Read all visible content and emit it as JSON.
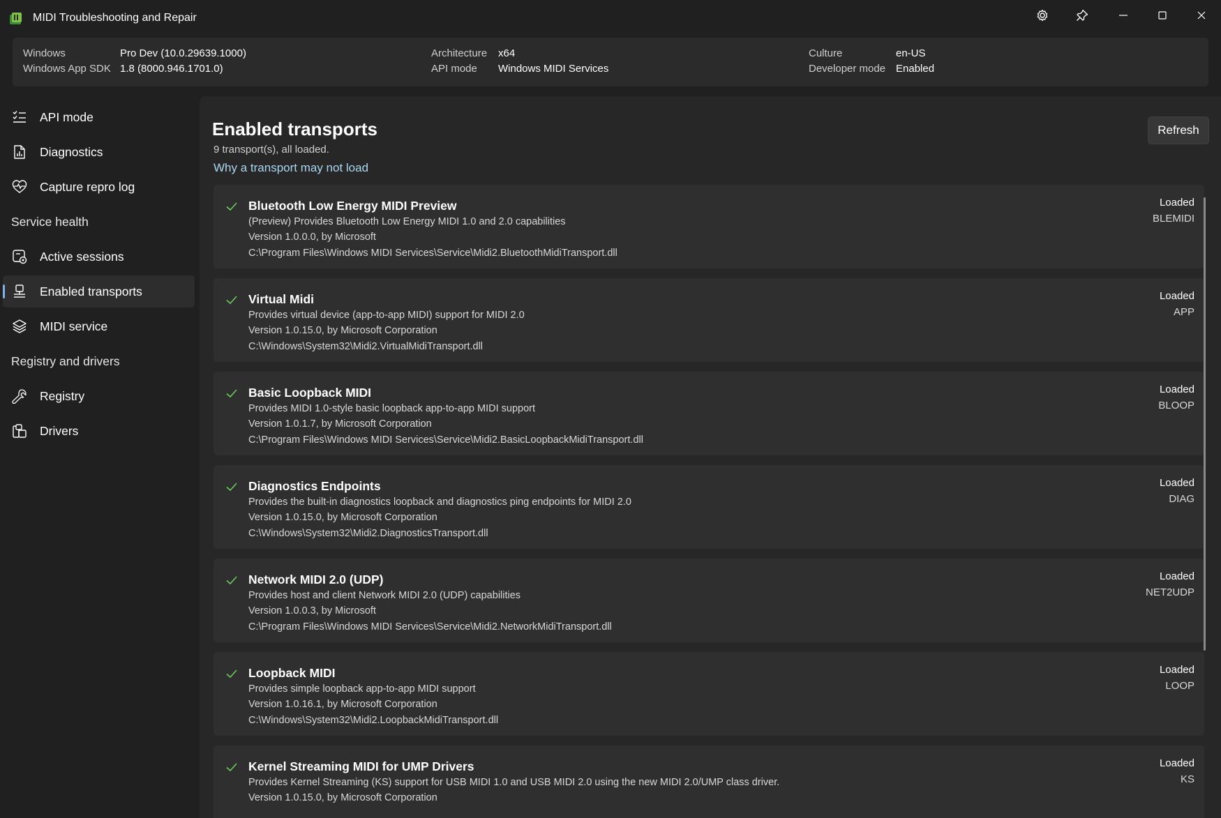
{
  "window": {
    "title": "MIDI Troubleshooting and Repair",
    "icons": [
      "settings-icon",
      "pin-icon",
      "minimize-icon",
      "maximize-icon",
      "close-icon"
    ]
  },
  "info": {
    "windows_label": "Windows",
    "windows_value": "Pro Dev (10.0.29639.1000)",
    "sdk_label": "Windows App SDK",
    "sdk_value": "1.8 (8000.946.1701.0)",
    "arch_label": "Architecture",
    "arch_value": "x64",
    "api_label": "API mode",
    "api_value": "Windows MIDI Services",
    "culture_label": "Culture",
    "culture_value": "en-US",
    "dev_label": "Developer mode",
    "dev_value": "Enabled"
  },
  "sidebar": {
    "items": [
      {
        "label": "API mode",
        "icon": "checklist-icon"
      },
      {
        "label": "Diagnostics",
        "icon": "document-chart-icon"
      },
      {
        "label": "Capture repro log",
        "icon": "heart-pulse-icon"
      },
      {
        "label": "Active sessions",
        "icon": "sessions-icon"
      },
      {
        "label": "Enabled transports",
        "icon": "transport-icon"
      },
      {
        "label": "MIDI service",
        "icon": "layers-icon"
      },
      {
        "label": "Registry",
        "icon": "wrench-icon"
      },
      {
        "label": "Drivers",
        "icon": "drivers-icon"
      }
    ],
    "headers": {
      "service_health": "Service health",
      "registry_drivers": "Registry and drivers"
    },
    "selected": "Enabled transports"
  },
  "page": {
    "title": "Enabled transports",
    "subtitle": "9 transport(s), all loaded.",
    "link": "Why a transport may not load",
    "refresh_label": "Refresh"
  },
  "transports": [
    {
      "name": "Bluetooth Low Energy MIDI Preview",
      "description": "(Preview) Provides Bluetooth Low Energy MIDI 1.0 and 2.0 capabilities",
      "version": "Version 1.0.0.0, by Microsoft",
      "path": "C:\\Program Files\\Windows MIDI Services\\Service\\Midi2.BluetoothMidiTransport.dll",
      "status": "Loaded",
      "code": "BLEMIDI"
    },
    {
      "name": "Virtual Midi",
      "description": "Provides virtual device (app-to-app MIDI) support for MIDI 2.0",
      "version": "Version 1.0.15.0, by Microsoft Corporation",
      "path": "C:\\Windows\\System32\\Midi2.VirtualMidiTransport.dll",
      "status": "Loaded",
      "code": "APP"
    },
    {
      "name": "Basic Loopback MIDI",
      "description": "Provides MIDI 1.0-style basic loopback app-to-app MIDI support",
      "version": "Version 1.0.1.7, by Microsoft Corporation",
      "path": "C:\\Program Files\\Windows MIDI Services\\Service\\Midi2.BasicLoopbackMidiTransport.dll",
      "status": "Loaded",
      "code": "BLOOP"
    },
    {
      "name": "Diagnostics Endpoints",
      "description": "Provides the built-in diagnostics loopback and diagnostics ping endpoints for MIDI 2.0",
      "version": "Version 1.0.15.0, by Microsoft Corporation",
      "path": "C:\\Windows\\System32\\Midi2.DiagnosticsTransport.dll",
      "status": "Loaded",
      "code": "DIAG"
    },
    {
      "name": "Network MIDI 2.0 (UDP)",
      "description": "Provides host and client Network MIDI 2.0 (UDP) capabilities",
      "version": "Version 1.0.0.3, by Microsoft",
      "path": "C:\\Program Files\\Windows MIDI Services\\Service\\Midi2.NetworkMidiTransport.dll",
      "status": "Loaded",
      "code": "NET2UDP"
    },
    {
      "name": "Loopback MIDI",
      "description": "Provides simple loopback app-to-app MIDI support",
      "version": "Version 1.0.16.1, by Microsoft Corporation",
      "path": "C:\\Windows\\System32\\Midi2.LoopbackMidiTransport.dll",
      "status": "Loaded",
      "code": "LOOP"
    },
    {
      "name": "Kernel Streaming MIDI for UMP Drivers",
      "description": "Provides Kernel Streaming (KS) support for USB MIDI 1.0 and USB MIDI 2.0 using the new MIDI 2.0/UMP class driver.",
      "version": "Version 1.0.15.0, by Microsoft Corporation",
      "path": "",
      "status": "Loaded",
      "code": "KS"
    }
  ],
  "colors": {
    "background": "#202020",
    "content": "#272727",
    "card": "#2f2f2f",
    "accent": "#7fb3e5",
    "link": "#a8d8f0",
    "check": "#6ccb5f"
  }
}
